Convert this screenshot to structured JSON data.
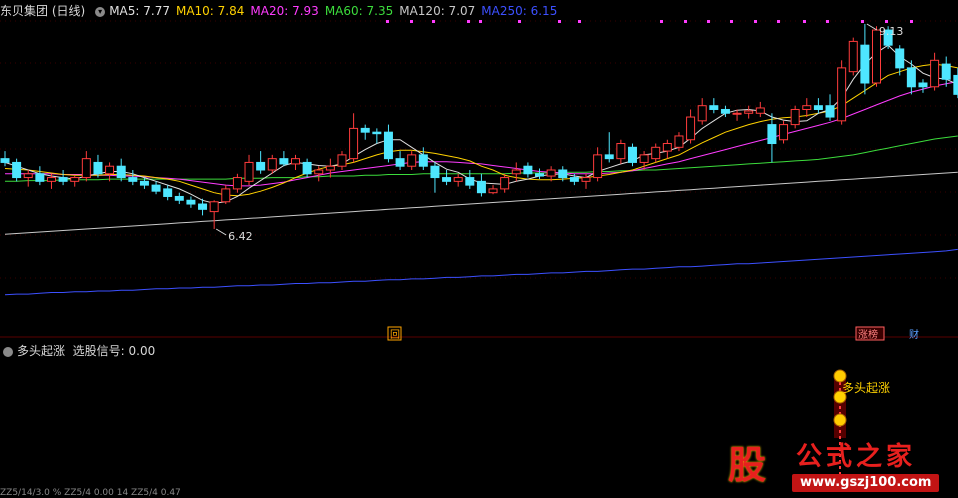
{
  "header": {
    "stock_title": "东贝集团 (日线)",
    "ma_items": [
      {
        "label": "MA5: 7.77",
        "color": "#e0e0e0"
      },
      {
        "label": "MA10: 7.84",
        "color": "#ffd200"
      },
      {
        "label": "MA20: 7.93",
        "color": "#ff3cff"
      },
      {
        "label": "MA60: 7.35",
        "color": "#3cdc3c"
      },
      {
        "label": "MA120: 7.07",
        "color": "#c8c8c8"
      },
      {
        "label": "MA250: 6.15",
        "color": "#3c50ff"
      }
    ]
  },
  "indicator": {
    "name": "多头起涨",
    "signal_label": "选股信号: 0.00",
    "signal_text": "多头起涨"
  },
  "markers": {
    "hui": "回",
    "zhangbang": "涨榜",
    "cai": "财"
  },
  "bottom_line": "ZZ5/14/3.0 % ZZ5/4 0.00 14 ZZ5/4 0.47",
  "logo": {
    "char": "股",
    "text": "公式之家",
    "url": "www.gszj100.com"
  },
  "colors": {
    "up": "#ff3c3c",
    "down": "#4ee6ff",
    "ma5": "#e0e0e0",
    "ma10": "#ffd200",
    "ma20": "#ff3cff",
    "ma60": "#3cdc3c",
    "ma120": "#c8c8c8",
    "ma250": "#3c50ff",
    "dots": "#ff3cff"
  },
  "chart_data": {
    "type": "candlestick",
    "low_label": "6.42",
    "high_label": "9.13",
    "candles": [
      {
        "o": 7.35,
        "h": 7.45,
        "l": 7.25,
        "c": 7.3
      },
      {
        "o": 7.3,
        "h": 7.35,
        "l": 7.05,
        "c": 7.1
      },
      {
        "o": 7.1,
        "h": 7.2,
        "l": 6.98,
        "c": 7.15
      },
      {
        "o": 7.15,
        "h": 7.25,
        "l": 7.0,
        "c": 7.05
      },
      {
        "o": 7.05,
        "h": 7.15,
        "l": 6.95,
        "c": 7.1
      },
      {
        "o": 7.1,
        "h": 7.2,
        "l": 7.0,
        "c": 7.05
      },
      {
        "o": 7.05,
        "h": 7.12,
        "l": 6.98,
        "c": 7.1
      },
      {
        "o": 7.1,
        "h": 7.45,
        "l": 7.05,
        "c": 7.35
      },
      {
        "o": 7.3,
        "h": 7.4,
        "l": 7.1,
        "c": 7.15
      },
      {
        "o": 7.15,
        "h": 7.3,
        "l": 7.05,
        "c": 7.25
      },
      {
        "o": 7.25,
        "h": 7.35,
        "l": 7.05,
        "c": 7.1
      },
      {
        "o": 7.1,
        "h": 7.2,
        "l": 7.0,
        "c": 7.05
      },
      {
        "o": 7.05,
        "h": 7.1,
        "l": 6.95,
        "c": 7.0
      },
      {
        "o": 7.0,
        "h": 7.05,
        "l": 6.88,
        "c": 6.92
      },
      {
        "o": 6.95,
        "h": 7.0,
        "l": 6.8,
        "c": 6.85
      },
      {
        "o": 6.85,
        "h": 6.9,
        "l": 6.75,
        "c": 6.8
      },
      {
        "o": 6.8,
        "h": 6.85,
        "l": 6.7,
        "c": 6.75
      },
      {
        "o": 6.75,
        "h": 6.82,
        "l": 6.6,
        "c": 6.68
      },
      {
        "o": 6.65,
        "h": 6.8,
        "l": 6.42,
        "c": 6.78
      },
      {
        "o": 6.78,
        "h": 7.0,
        "l": 6.75,
        "c": 6.95
      },
      {
        "o": 6.95,
        "h": 7.15,
        "l": 6.9,
        "c": 7.1
      },
      {
        "o": 7.05,
        "h": 7.4,
        "l": 7.0,
        "c": 7.3
      },
      {
        "o": 7.3,
        "h": 7.45,
        "l": 7.15,
        "c": 7.2
      },
      {
        "o": 7.2,
        "h": 7.4,
        "l": 7.15,
        "c": 7.35
      },
      {
        "o": 7.35,
        "h": 7.45,
        "l": 7.25,
        "c": 7.28
      },
      {
        "o": 7.28,
        "h": 7.4,
        "l": 7.2,
        "c": 7.35
      },
      {
        "o": 7.3,
        "h": 7.35,
        "l": 7.1,
        "c": 7.15
      },
      {
        "o": 7.15,
        "h": 7.25,
        "l": 7.05,
        "c": 7.2
      },
      {
        "o": 7.2,
        "h": 7.35,
        "l": 7.1,
        "c": 7.25
      },
      {
        "o": 7.25,
        "h": 7.45,
        "l": 7.2,
        "c": 7.4
      },
      {
        "o": 7.35,
        "h": 7.95,
        "l": 7.3,
        "c": 7.75
      },
      {
        "o": 7.75,
        "h": 7.8,
        "l": 7.6,
        "c": 7.7
      },
      {
        "o": 7.7,
        "h": 7.75,
        "l": 7.55,
        "c": 7.68
      },
      {
        "o": 7.7,
        "h": 7.8,
        "l": 7.3,
        "c": 7.35
      },
      {
        "o": 7.35,
        "h": 7.45,
        "l": 7.2,
        "c": 7.25
      },
      {
        "o": 7.25,
        "h": 7.45,
        "l": 7.2,
        "c": 7.4
      },
      {
        "o": 7.4,
        "h": 7.5,
        "l": 7.2,
        "c": 7.25
      },
      {
        "o": 7.25,
        "h": 7.3,
        "l": 6.9,
        "c": 7.1
      },
      {
        "o": 7.1,
        "h": 7.2,
        "l": 7.0,
        "c": 7.05
      },
      {
        "o": 7.05,
        "h": 7.15,
        "l": 6.98,
        "c": 7.1
      },
      {
        "o": 7.1,
        "h": 7.2,
        "l": 6.95,
        "c": 7.0
      },
      {
        "o": 7.05,
        "h": 7.15,
        "l": 6.85,
        "c": 6.9
      },
      {
        "o": 6.9,
        "h": 7.0,
        "l": 6.88,
        "c": 6.95
      },
      {
        "o": 6.95,
        "h": 7.15,
        "l": 6.9,
        "c": 7.1
      },
      {
        "o": 7.15,
        "h": 7.3,
        "l": 7.05,
        "c": 7.2
      },
      {
        "o": 7.25,
        "h": 7.3,
        "l": 7.1,
        "c": 7.15
      },
      {
        "o": 7.15,
        "h": 7.22,
        "l": 7.08,
        "c": 7.12
      },
      {
        "o": 7.12,
        "h": 7.25,
        "l": 7.05,
        "c": 7.2
      },
      {
        "o": 7.2,
        "h": 7.25,
        "l": 7.05,
        "c": 7.1
      },
      {
        "o": 7.1,
        "h": 7.15,
        "l": 7.0,
        "c": 7.05
      },
      {
        "o": 7.05,
        "h": 7.15,
        "l": 6.95,
        "c": 7.1
      },
      {
        "o": 7.1,
        "h": 7.5,
        "l": 7.05,
        "c": 7.4
      },
      {
        "o": 7.4,
        "h": 7.7,
        "l": 7.3,
        "c": 7.35
      },
      {
        "o": 7.35,
        "h": 7.6,
        "l": 7.28,
        "c": 7.55
      },
      {
        "o": 7.5,
        "h": 7.55,
        "l": 7.25,
        "c": 7.3
      },
      {
        "o": 7.3,
        "h": 7.45,
        "l": 7.2,
        "c": 7.4
      },
      {
        "o": 7.35,
        "h": 7.55,
        "l": 7.3,
        "c": 7.5
      },
      {
        "o": 7.45,
        "h": 7.6,
        "l": 7.35,
        "c": 7.55
      },
      {
        "o": 7.5,
        "h": 7.7,
        "l": 7.45,
        "c": 7.65
      },
      {
        "o": 7.6,
        "h": 8.0,
        "l": 7.55,
        "c": 7.9
      },
      {
        "o": 7.85,
        "h": 8.15,
        "l": 7.8,
        "c": 8.05
      },
      {
        "o": 8.05,
        "h": 8.15,
        "l": 7.95,
        "c": 8.0
      },
      {
        "o": 8.0,
        "h": 8.05,
        "l": 7.9,
        "c": 7.95
      },
      {
        "o": 7.95,
        "h": 8.0,
        "l": 7.85,
        "c": 7.95
      },
      {
        "o": 7.95,
        "h": 8.05,
        "l": 7.88,
        "c": 7.98
      },
      {
        "o": 7.95,
        "h": 8.1,
        "l": 7.9,
        "c": 8.02
      },
      {
        "o": 7.8,
        "h": 7.95,
        "l": 7.3,
        "c": 7.55
      },
      {
        "o": 7.6,
        "h": 7.85,
        "l": 7.55,
        "c": 7.8
      },
      {
        "o": 7.8,
        "h": 8.05,
        "l": 7.75,
        "c": 8.0
      },
      {
        "o": 8.0,
        "h": 8.15,
        "l": 7.9,
        "c": 8.05
      },
      {
        "o": 8.05,
        "h": 8.15,
        "l": 7.95,
        "c": 8.0
      },
      {
        "o": 8.05,
        "h": 8.2,
        "l": 7.85,
        "c": 7.9
      },
      {
        "o": 7.85,
        "h": 8.65,
        "l": 7.8,
        "c": 8.55
      },
      {
        "o": 8.5,
        "h": 8.95,
        "l": 8.45,
        "c": 8.9
      },
      {
        "o": 8.85,
        "h": 9.13,
        "l": 8.2,
        "c": 8.35
      },
      {
        "o": 8.35,
        "h": 9.1,
        "l": 8.3,
        "c": 9.05
      },
      {
        "o": 9.05,
        "h": 9.1,
        "l": 8.8,
        "c": 8.85
      },
      {
        "o": 8.8,
        "h": 8.85,
        "l": 8.45,
        "c": 8.55
      },
      {
        "o": 8.55,
        "h": 8.65,
        "l": 8.2,
        "c": 8.3
      },
      {
        "o": 8.35,
        "h": 8.4,
        "l": 8.22,
        "c": 8.3
      },
      {
        "o": 8.3,
        "h": 8.75,
        "l": 8.25,
        "c": 8.65
      },
      {
        "o": 8.6,
        "h": 8.7,
        "l": 8.3,
        "c": 8.4
      },
      {
        "o": 8.45,
        "h": 8.55,
        "l": 8.15,
        "c": 8.2
      }
    ],
    "ma5": [
      7.3,
      7.25,
      7.2,
      7.15,
      7.12,
      7.1,
      7.08,
      7.12,
      7.15,
      7.18,
      7.18,
      7.15,
      7.1,
      7.05,
      7.0,
      6.95,
      6.88,
      6.8,
      6.76,
      6.78,
      6.85,
      6.96,
      7.06,
      7.16,
      7.26,
      7.3,
      7.28,
      7.26,
      7.25,
      7.28,
      7.38,
      7.47,
      7.55,
      7.6,
      7.6,
      7.5,
      7.4,
      7.3,
      7.21,
      7.17,
      7.08,
      7.03,
      7.02,
      7.01,
      7.05,
      7.08,
      7.12,
      7.14,
      7.15,
      7.12,
      7.1,
      7.18,
      7.23,
      7.28,
      7.32,
      7.4,
      7.42,
      7.45,
      7.5,
      7.62,
      7.75,
      7.85,
      7.95,
      7.99,
      8.0,
      7.98,
      7.9,
      7.86,
      7.84,
      7.85,
      7.95,
      8.0,
      8.15,
      8.4,
      8.6,
      8.75,
      8.85,
      8.7,
      8.6,
      8.48,
      8.42,
      8.4,
      8.33
    ],
    "ma10": [
      7.22,
      7.21,
      7.2,
      7.18,
      7.16,
      7.14,
      7.13,
      7.13,
      7.13,
      7.14,
      7.14,
      7.13,
      7.12,
      7.1,
      7.08,
      7.05,
      7.0,
      6.95,
      6.9,
      6.87,
      6.86,
      6.88,
      6.92,
      6.97,
      7.03,
      7.1,
      7.16,
      7.21,
      7.25,
      7.27,
      7.3,
      7.35,
      7.4,
      7.44,
      7.46,
      7.46,
      7.44,
      7.42,
      7.39,
      7.36,
      7.32,
      7.25,
      7.2,
      7.13,
      7.1,
      7.08,
      7.07,
      7.07,
      7.08,
      7.09,
      7.1,
      7.12,
      7.14,
      7.17,
      7.2,
      7.25,
      7.3,
      7.35,
      7.4,
      7.48,
      7.56,
      7.63,
      7.7,
      7.75,
      7.8,
      7.84,
      7.87,
      7.89,
      7.9,
      7.92,
      7.95,
      7.98,
      8.05,
      8.15,
      8.25,
      8.35,
      8.45,
      8.5,
      8.55,
      8.58,
      8.6,
      8.58,
      8.55
    ],
    "ma20": [
      7.15,
      7.15,
      7.15,
      7.15,
      7.15,
      7.14,
      7.14,
      7.14,
      7.13,
      7.13,
      7.12,
      7.12,
      7.11,
      7.1,
      7.09,
      7.08,
      7.06,
      7.04,
      7.02,
      7.0,
      6.99,
      6.99,
      7.0,
      7.02,
      7.04,
      7.07,
      7.1,
      7.13,
      7.16,
      7.18,
      7.2,
      7.22,
      7.24,
      7.26,
      7.28,
      7.3,
      7.31,
      7.31,
      7.31,
      7.3,
      7.29,
      7.28,
      7.26,
      7.24,
      7.22,
      7.2,
      7.18,
      7.17,
      7.16,
      7.15,
      7.15,
      7.15,
      7.16,
      7.17,
      7.19,
      7.22,
      7.25,
      7.28,
      7.31,
      7.35,
      7.39,
      7.43,
      7.47,
      7.51,
      7.55,
      7.59,
      7.63,
      7.67,
      7.71,
      7.75,
      7.79,
      7.83,
      7.88,
      7.94,
      8.0,
      8.06,
      8.12,
      8.18,
      8.23,
      8.27,
      8.31,
      8.34,
      8.37
    ],
    "ma60": [
      7.05,
      7.05,
      7.06,
      7.06,
      7.06,
      7.07,
      7.07,
      7.07,
      7.07,
      7.08,
      7.08,
      7.08,
      7.08,
      7.08,
      7.08,
      7.08,
      7.08,
      7.08,
      7.08,
      7.08,
      7.09,
      7.09,
      7.09,
      7.1,
      7.1,
      7.1,
      7.11,
      7.11,
      7.12,
      7.12,
      7.12,
      7.13,
      7.13,
      7.14,
      7.14,
      7.14,
      7.15,
      7.15,
      7.15,
      7.15,
      7.15,
      7.15,
      7.15,
      7.15,
      7.16,
      7.16,
      7.16,
      7.16,
      7.17,
      7.17,
      7.17,
      7.18,
      7.18,
      7.19,
      7.19,
      7.2,
      7.2,
      7.21,
      7.22,
      7.23,
      7.24,
      7.25,
      7.26,
      7.27,
      7.28,
      7.29,
      7.3,
      7.31,
      7.32,
      7.33,
      7.34,
      7.36,
      7.38,
      7.4,
      7.43,
      7.46,
      7.49,
      7.52,
      7.55,
      7.58,
      7.61,
      7.63,
      7.65
    ],
    "ma120": [
      6.35,
      6.36,
      6.37,
      6.38,
      6.39,
      6.4,
      6.41,
      6.42,
      6.43,
      6.44,
      6.45,
      6.46,
      6.47,
      6.48,
      6.49,
      6.5,
      6.51,
      6.52,
      6.53,
      6.54,
      6.55,
      6.56,
      6.57,
      6.58,
      6.59,
      6.6,
      6.61,
      6.62,
      6.63,
      6.64,
      6.65,
      6.66,
      6.67,
      6.68,
      6.69,
      6.7,
      6.71,
      6.72,
      6.73,
      6.74,
      6.75,
      6.76,
      6.77,
      6.78,
      6.79,
      6.8,
      6.81,
      6.82,
      6.83,
      6.84,
      6.85,
      6.86,
      6.87,
      6.88,
      6.89,
      6.9,
      6.91,
      6.92,
      6.93,
      6.94,
      6.95,
      6.96,
      6.97,
      6.98,
      6.99,
      7.0,
      7.01,
      7.02,
      7.03,
      7.04,
      7.05,
      7.06,
      7.07,
      7.08,
      7.09,
      7.1,
      7.11,
      7.12,
      7.13,
      7.14,
      7.15,
      7.16,
      7.17
    ],
    "ma250": [
      5.55,
      5.56,
      5.56,
      5.57,
      5.58,
      5.58,
      5.59,
      5.59,
      5.6,
      5.6,
      5.61,
      5.61,
      5.62,
      5.63,
      5.63,
      5.64,
      5.64,
      5.65,
      5.65,
      5.66,
      5.67,
      5.67,
      5.68,
      5.68,
      5.69,
      5.7,
      5.7,
      5.71,
      5.71,
      5.72,
      5.73,
      5.73,
      5.74,
      5.75,
      5.75,
      5.76,
      5.76,
      5.77,
      5.78,
      5.78,
      5.79,
      5.8,
      5.8,
      5.81,
      5.82,
      5.82,
      5.83,
      5.84,
      5.84,
      5.85,
      5.86,
      5.86,
      5.87,
      5.88,
      5.89,
      5.89,
      5.9,
      5.91,
      5.92,
      5.92,
      5.93,
      5.94,
      5.95,
      5.96,
      5.96,
      5.97,
      5.98,
      5.99,
      6.0,
      6.01,
      6.02,
      6.03,
      6.04,
      6.05,
      6.06,
      6.07,
      6.08,
      6.09,
      6.1,
      6.11,
      6.12,
      6.13,
      6.15
    ]
  }
}
